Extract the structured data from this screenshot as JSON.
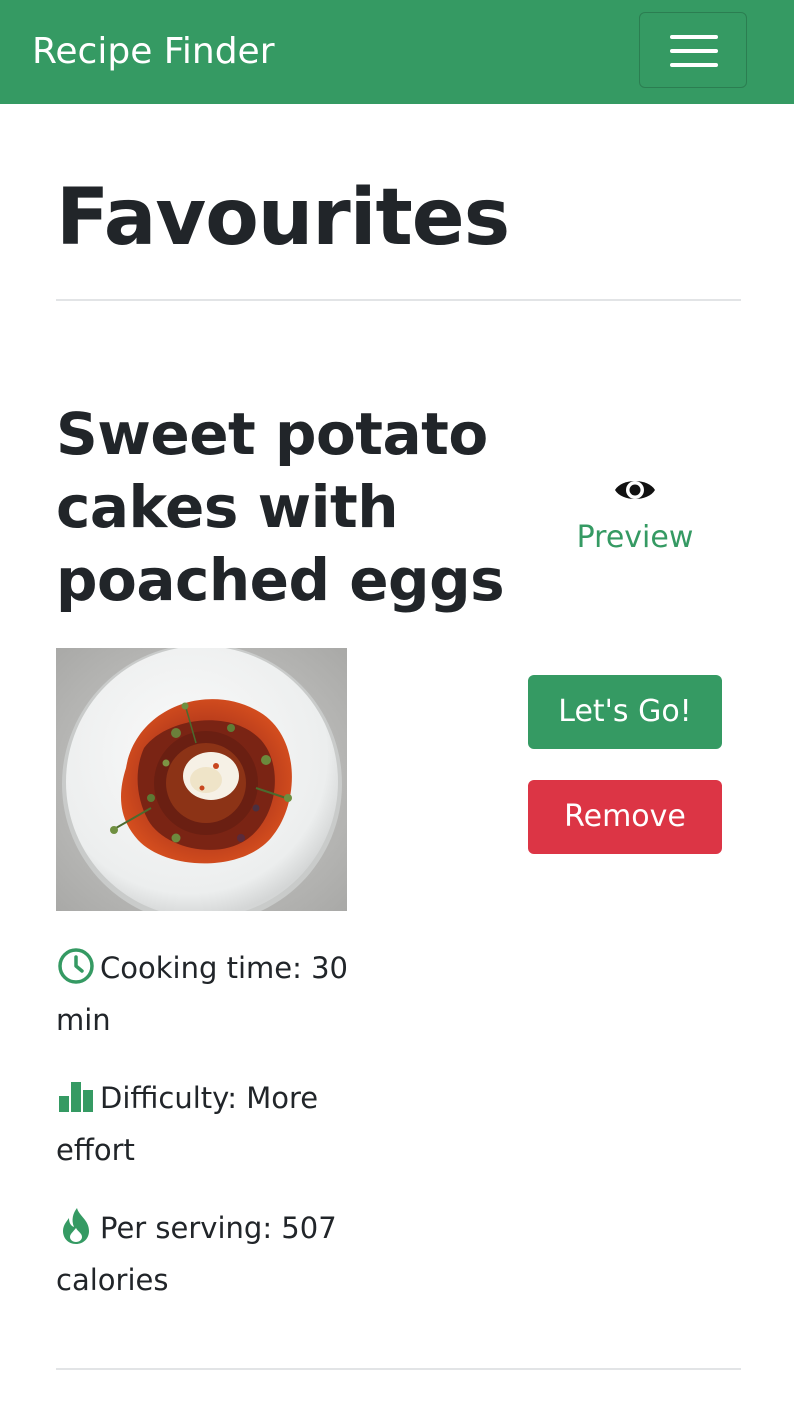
{
  "navbar": {
    "brand": "Recipe Finder",
    "menu_icon": "hamburger-menu-icon",
    "color": "#359a63"
  },
  "page": {
    "title": "Favourites"
  },
  "recipe": {
    "title": "Sweet potato cakes with poached eggs",
    "image_alt": "Sweet potato cakes with poached eggs on a white plate",
    "preview_label": "Preview",
    "preview_icon": "eye-icon",
    "go_label": "Let's Go!",
    "remove_label": "Remove",
    "cooking_time": "Cooking time: 30 min",
    "cooking_time_icon": "clock-icon",
    "difficulty": "Difficulty: More effort",
    "difficulty_icon": "bar-chart-icon",
    "calories": "Per serving: 507 calories",
    "calories_icon": "flame-icon"
  },
  "colors": {
    "accent": "#359a63",
    "danger": "#dc3545",
    "text": "#212529"
  }
}
